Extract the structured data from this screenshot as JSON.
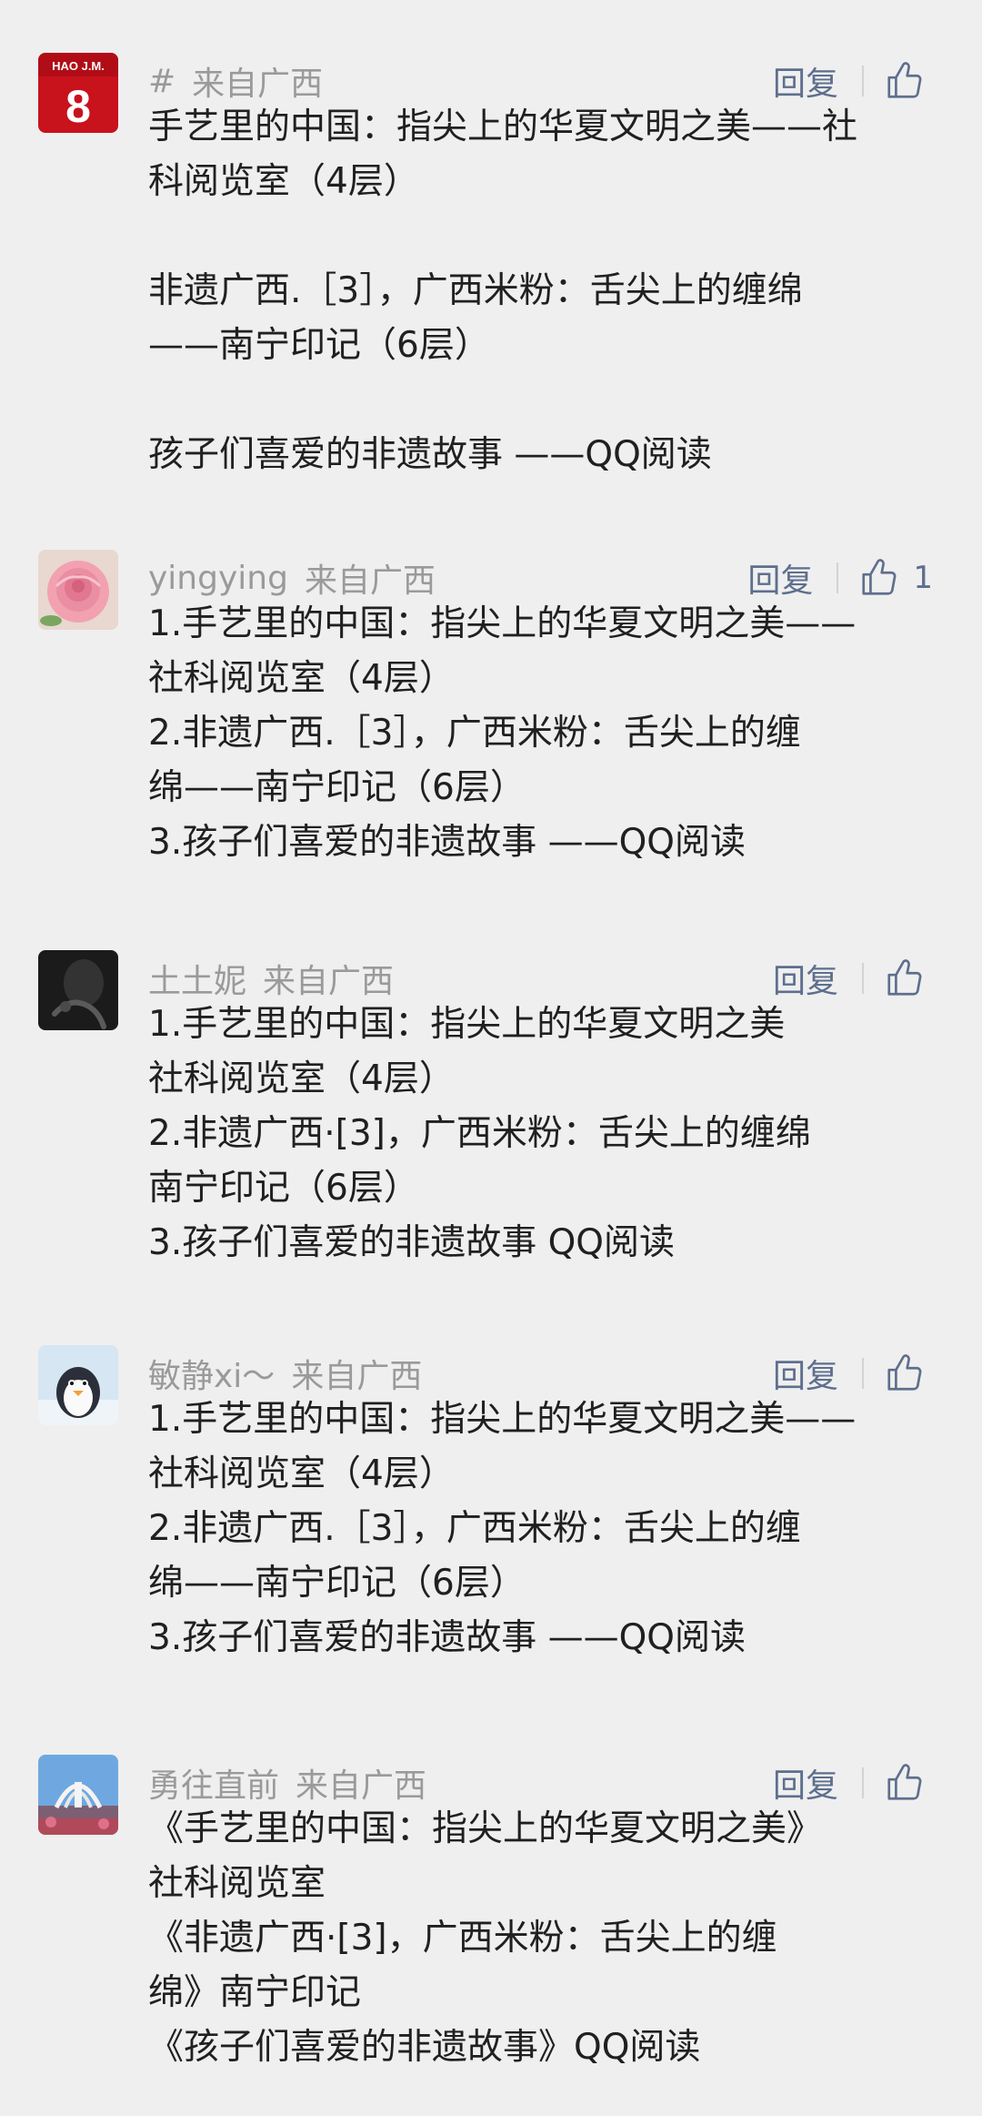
{
  "comments": [
    {
      "name": "#",
      "location": "来自广西",
      "reply": "回复",
      "likes": "",
      "avatar_text": "HAO J.M.",
      "avatar_number": "8",
      "lines": [
        "手艺里的中国：指尖上的华夏文明之美——社",
        "科阅览室（4层）",
        "",
        "非遗广西.［3］，广西米粉：舌尖上的缠绵",
        "——南宁印记（6层）",
        "",
        "孩子们喜爱的非遗故事 ——QQ阅读"
      ]
    },
    {
      "name": "yingying",
      "location": "来自广西",
      "reply": "回复",
      "likes": "1",
      "lines": [
        "1.手艺里的中国：指尖上的华夏文明之美——",
        "社科阅览室（4层）",
        "2.非遗广西.［3］，广西米粉：舌尖上的缠",
        "绵——南宁印记（6层）",
        "3.孩子们喜爱的非遗故事 ——QQ阅读"
      ]
    },
    {
      "name": "土土妮",
      "location": "来自广西",
      "reply": "回复",
      "likes": "",
      "lines": [
        "1.手艺里的中国：指尖上的华夏文明之美",
        "社科阅览室（4层）",
        "2.非遗广西·[3]，广西米粉：舌尖上的缠绵",
        "南宁印记（6层）",
        "3.孩子们喜爱的非遗故事 QQ阅读"
      ]
    },
    {
      "name": "敏静xi～",
      "location": "来自广西",
      "reply": "回复",
      "likes": "",
      "lines": [
        "1.手艺里的中国：指尖上的华夏文明之美——",
        "社科阅览室（4层）",
        "2.非遗广西.［3］，广西米粉：舌尖上的缠",
        "绵——南宁印记（6层）",
        "3.孩子们喜爱的非遗故事 ——QQ阅读"
      ]
    },
    {
      "name": "勇往直前",
      "location": "来自广西",
      "reply": "回复",
      "likes": "",
      "lines": [
        "《手艺里的中国：指尖上的华夏文明之美》",
        "社科阅览室",
        "《非遗广西·[3]，广西米粉：舌尖上的缠",
        "绵》南宁印记",
        "《孩子们喜爱的非遗故事》QQ阅读"
      ]
    }
  ],
  "colors": {
    "background": "#efefef",
    "meta_text": "#9a9a9a",
    "action_blue": "#5e6f8e",
    "body_text": "#202020"
  },
  "icons": {
    "like": "thumbs-up-outline-icon"
  }
}
